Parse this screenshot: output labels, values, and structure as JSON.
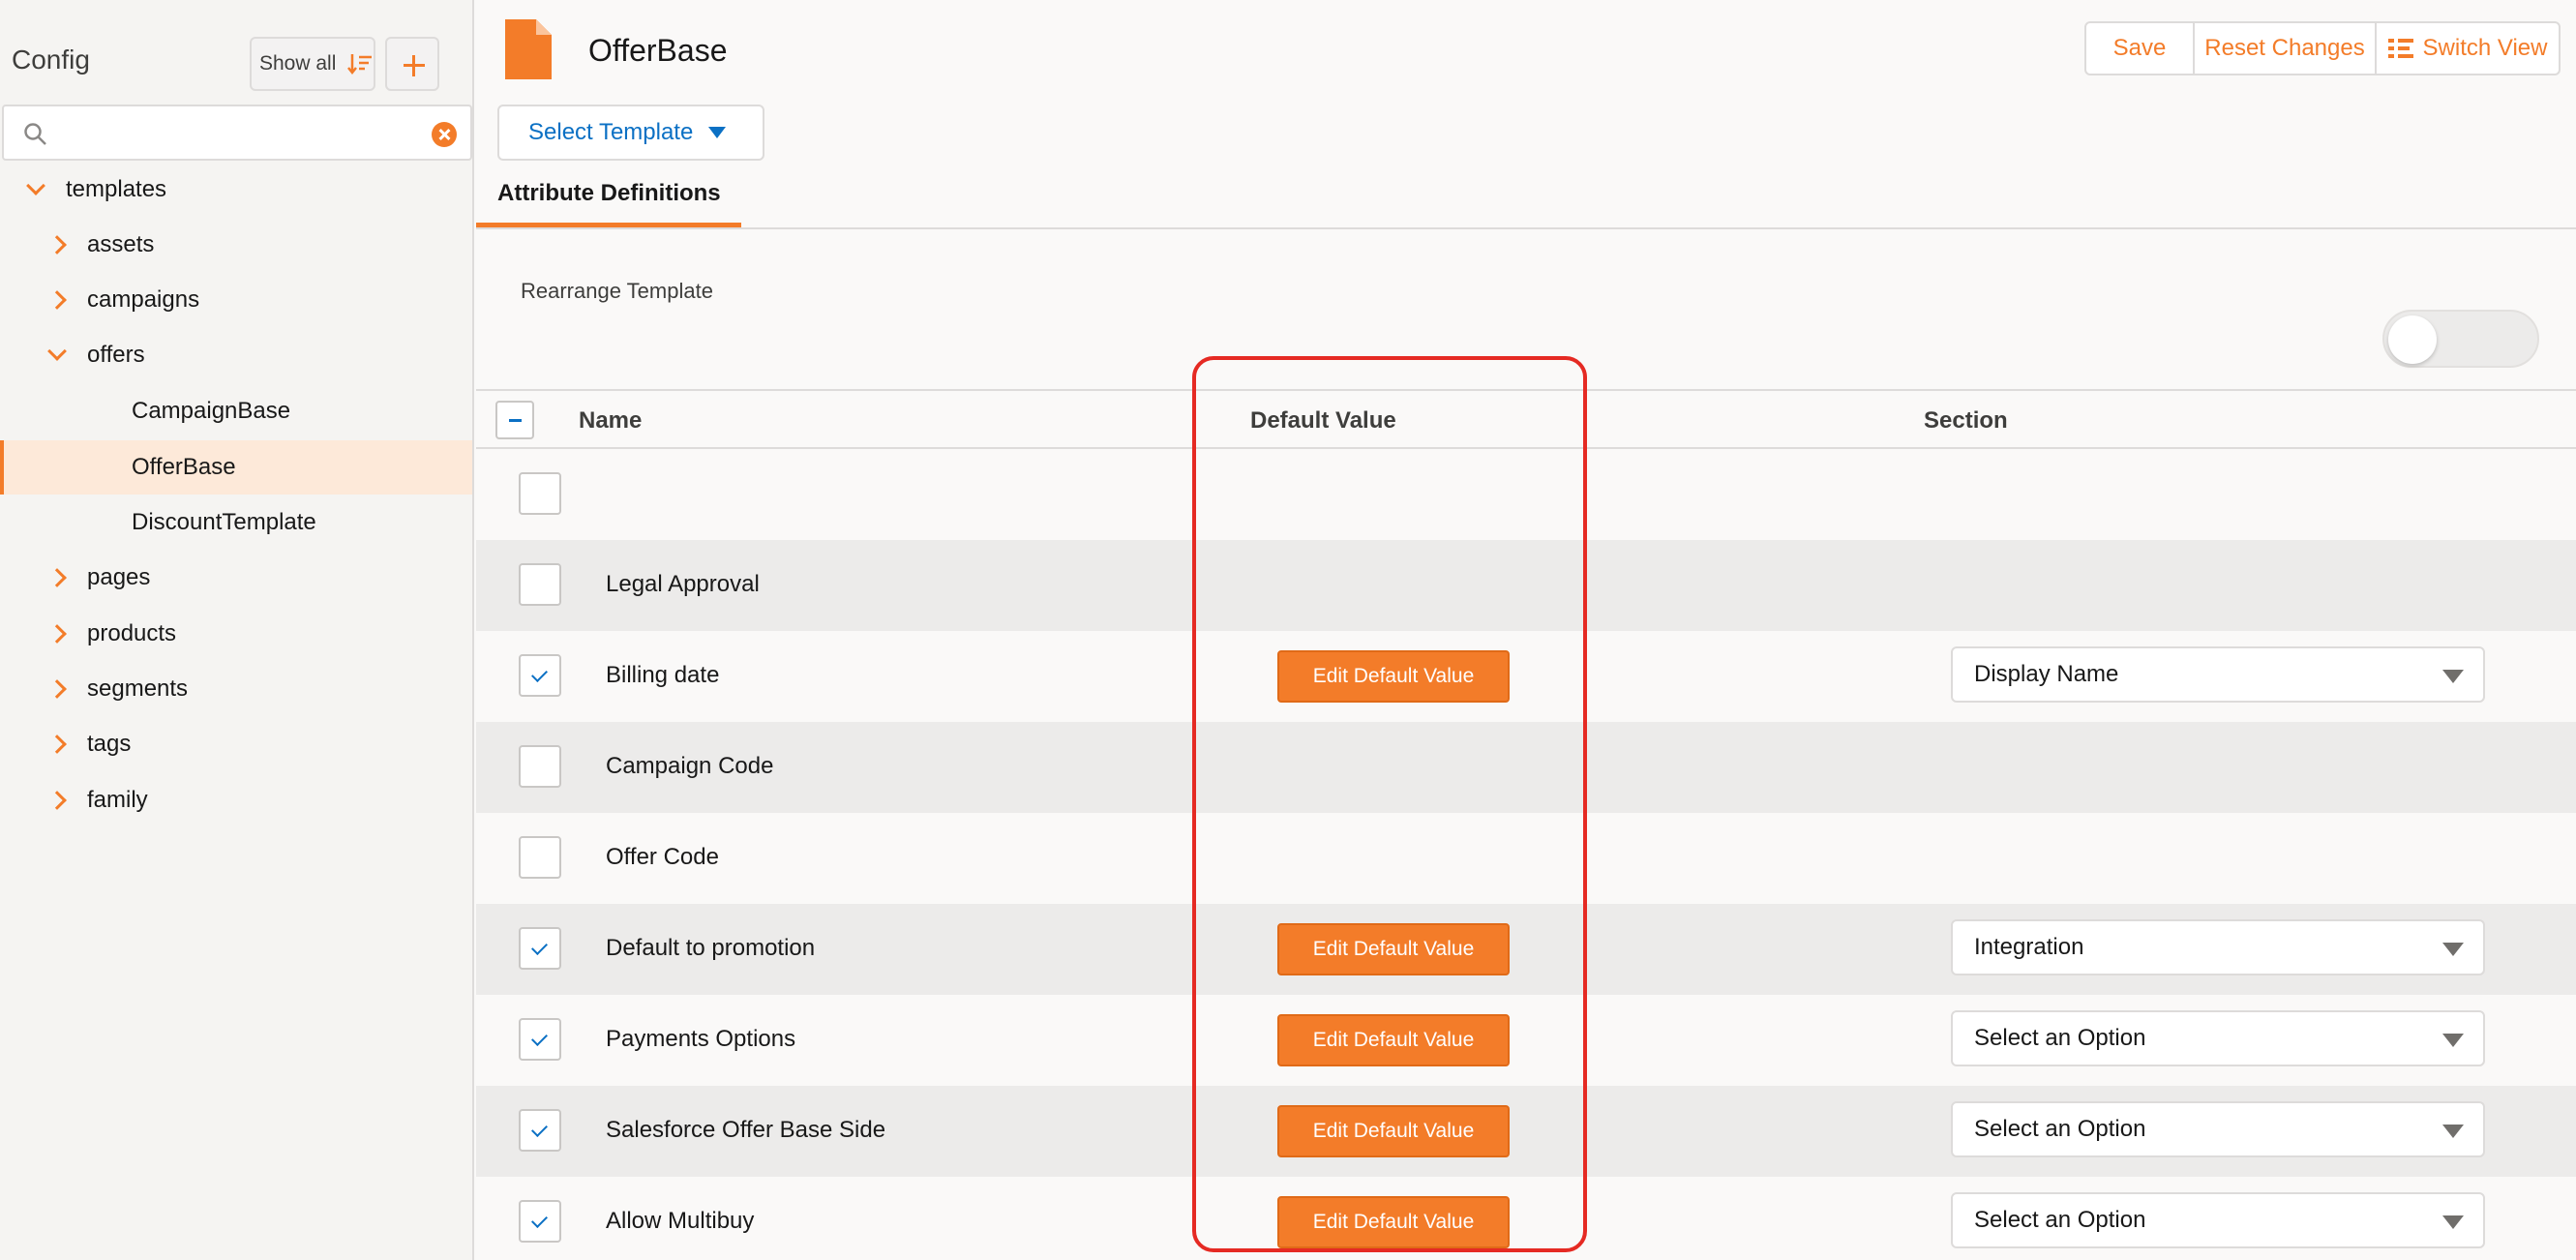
{
  "sidebar": {
    "title": "Config",
    "show_all_label": "Show all",
    "search_placeholder": "",
    "tree": [
      {
        "label": "templates",
        "expanded": true,
        "level": 0
      },
      {
        "label": "assets",
        "expanded": false,
        "level": 1
      },
      {
        "label": "campaigns",
        "expanded": false,
        "level": 1
      },
      {
        "label": "offers",
        "expanded": true,
        "level": 1
      },
      {
        "label": "CampaignBase",
        "level": 2
      },
      {
        "label": "OfferBase",
        "level": 2,
        "selected": true
      },
      {
        "label": "DiscountTemplate",
        "level": 2
      },
      {
        "label": "pages",
        "expanded": false,
        "level": 1
      },
      {
        "label": "products",
        "expanded": false,
        "level": 1
      },
      {
        "label": "segments",
        "expanded": false,
        "level": 1
      },
      {
        "label": "tags",
        "expanded": false,
        "level": 1
      },
      {
        "label": "family",
        "expanded": false,
        "level": 1
      }
    ]
  },
  "header": {
    "title": "OfferBase",
    "save_label": "Save",
    "reset_label": "Reset Changes",
    "switch_label": "Switch View",
    "select_template_label": "Select Template"
  },
  "tabs": [
    {
      "label": "Attribute Definitions",
      "active": true
    }
  ],
  "rearrange_label": "Rearrange Template",
  "rearrange_enabled": false,
  "table": {
    "columns": [
      "Name",
      "Default Value",
      "Section"
    ],
    "rows": [
      {
        "name": "",
        "checked": false,
        "has_default": false,
        "section": ""
      },
      {
        "name": "Legal Approval",
        "checked": false,
        "has_default": false,
        "section": ""
      },
      {
        "name": "Billing date",
        "checked": true,
        "has_default": true,
        "section": "Display Name"
      },
      {
        "name": "Campaign Code",
        "checked": false,
        "has_default": false,
        "section": ""
      },
      {
        "name": "Offer Code",
        "checked": false,
        "has_default": false,
        "section": ""
      },
      {
        "name": "Default to promotion",
        "checked": true,
        "has_default": true,
        "section": "Integration"
      },
      {
        "name": "Payments Options",
        "checked": true,
        "has_default": true,
        "section": "Select an Option"
      },
      {
        "name": "Salesforce Offer Base Side",
        "checked": true,
        "has_default": true,
        "section": "Select an Option"
      },
      {
        "name": "Allow Multibuy",
        "checked": true,
        "has_default": true,
        "section": "Select an Option"
      }
    ],
    "edit_default_label": "Edit Default Value"
  },
  "colors": {
    "accent": "#f37c29",
    "link": "#0b70c4",
    "highlight": "#e52a23"
  }
}
